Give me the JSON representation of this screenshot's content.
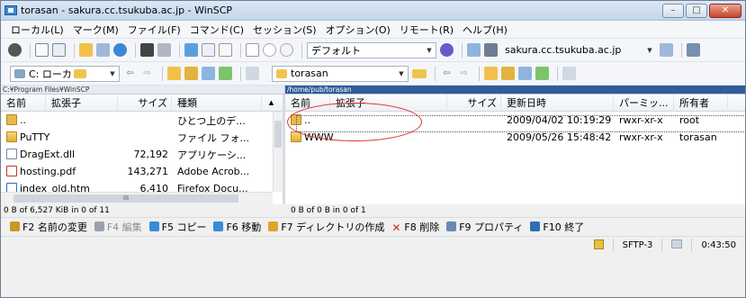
{
  "window": {
    "title": "torasan - sakura.cc.tsukuba.ac.jp - WinSCP",
    "min": "–",
    "max": "□",
    "close": "✕"
  },
  "menu": [
    "ローカル(L)",
    "マーク(M)",
    "ファイル(F)",
    "コマンド(C)",
    "セッション(S)",
    "オプション(O)",
    "リモート(R)",
    "ヘルプ(H)"
  ],
  "toolbar1": {
    "preset": "デフォルト",
    "host": "sakura.cc.tsukuba.ac.jp"
  },
  "toolbar2": {
    "local_drive": "C: ローカ",
    "remote_dir": "torasan"
  },
  "paths": {
    "local": "C:¥Program Files¥WinSCP",
    "remote": "/home/pub/torasan"
  },
  "local_pane": {
    "columns": [
      "名前",
      "拡張子",
      "サイズ",
      "種類"
    ],
    "rows": [
      {
        "name": "..",
        "size": "",
        "type": "ひとつ上のデ...",
        "icon": "up-folder-icon"
      },
      {
        "name": "PuTTY",
        "size": "",
        "type": "ファイル フォ...",
        "icon": "folder-icon"
      },
      {
        "name": "DragExt.dll",
        "size": "72,192",
        "type": "アプリケーシ...",
        "icon": "dll-file-icon"
      },
      {
        "name": "hosting.pdf",
        "size": "143,271",
        "type": "Adobe Acrob...",
        "icon": "pdf-file-icon"
      },
      {
        "name": "index_old.htm",
        "size": "6,410",
        "type": "Firefox Docu...",
        "icon": "html-file-icon"
      }
    ],
    "status": "0 B of 6,527 KiB in 0 of 11"
  },
  "remote_pane": {
    "columns": [
      "名前",
      "拡張子",
      "サイズ",
      "更新日時",
      "パーミッ...",
      "所有者"
    ],
    "rows": [
      {
        "name": "..",
        "size": "",
        "date": "2009/04/02 10:19:29",
        "perm": "rwxr-xr-x",
        "owner": "root",
        "icon": "up-folder-icon"
      },
      {
        "name": "WWW",
        "size": "",
        "date": "2009/05/26 15:48:42",
        "perm": "rwxr-xr-x",
        "owner": "torasan",
        "icon": "folder-icon"
      }
    ],
    "status": "0 B of 0 B in 0 of 1"
  },
  "commands": [
    {
      "label": "F2 名前の変更",
      "color": "#c79a20"
    },
    {
      "label": "F4 編集",
      "color": "#9aa3ad"
    },
    {
      "label": "F5 コピー",
      "color": "#3a8ad8"
    },
    {
      "label": "F6 移動",
      "color": "#3a8ad8"
    },
    {
      "label": "F7 ディレクトリの作成",
      "color": "#e0a32a"
    },
    {
      "label": "F8 削除",
      "color": "#d0281c"
    },
    {
      "label": "F9 プロパティ",
      "color": "#6a8ab4"
    },
    {
      "label": "F10 終了",
      "color": "#2d6fb3"
    }
  ],
  "statusbar": {
    "protocol": "SFTP-3",
    "time": "0:43:50"
  },
  "colors": {
    "accent": "#2f5d9a",
    "highlight": "#d33333"
  }
}
